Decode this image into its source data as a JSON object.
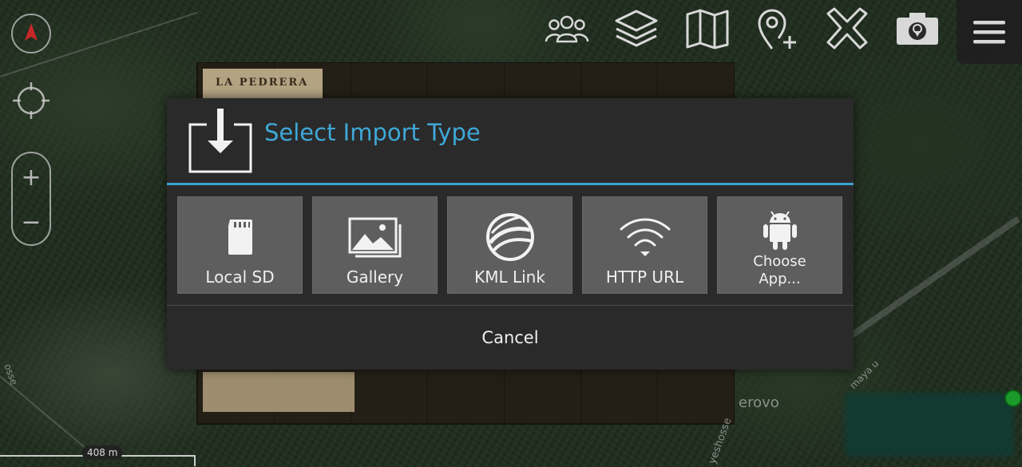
{
  "map": {
    "overlay_title": "LA PEDRERA",
    "place_label": "erovo",
    "road_label_1": "osse",
    "road_label_2": "yeshosse",
    "road_label_3": "maya u",
    "scale": "408 m"
  },
  "toolbar": {
    "icons": [
      "group-icon",
      "layers-icon",
      "map-icon",
      "add-location-icon",
      "close-tools-icon",
      "camera-icon",
      "menu-icon"
    ]
  },
  "controls": {
    "zoom_in": "+",
    "zoom_out": "−"
  },
  "dialog": {
    "title": "Select Import Type",
    "options": [
      {
        "label": "Local SD",
        "icon": "sd-card-icon"
      },
      {
        "label": "Gallery",
        "icon": "gallery-icon"
      },
      {
        "label": "KML Link",
        "icon": "google-earth-icon"
      },
      {
        "label": "HTTP URL",
        "icon": "wifi-icon"
      },
      {
        "label_line1": "Choose",
        "label_line2": "App...",
        "icon": "android-icon"
      }
    ],
    "cancel": "Cancel"
  },
  "colors": {
    "accent": "#3fa8d8",
    "dialog_bg": "#2a2a2a",
    "option_bg": "#5e5e5e",
    "compass_red": "#c62828",
    "gps_green": "#1c9a2a"
  }
}
